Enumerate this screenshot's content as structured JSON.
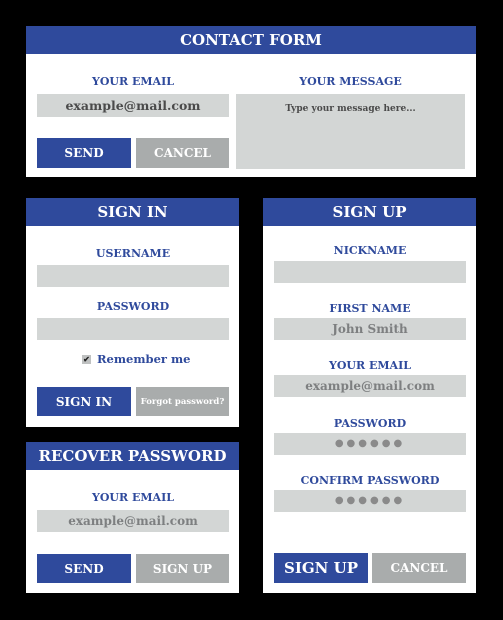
{
  "contact": {
    "title": "CONTACT FORM",
    "email_label": "YOUR EMAIL",
    "email_value": "example@mail.com",
    "message_label": "YOUR MESSAGE",
    "message_placeholder": "Type your message here...",
    "send": "SEND",
    "cancel": "CANCEL"
  },
  "signin": {
    "title": "SIGN IN",
    "username_label": "USERNAME",
    "username_value": "",
    "password_label": "PASSWORD",
    "password_value": "",
    "remember": "Remember me",
    "remember_checked": true,
    "check_glyph": "✔",
    "signin": "SIGN IN",
    "forgot": "Forgot password?"
  },
  "recover": {
    "title": "RECOVER PASSWORD",
    "email_label": "YOUR EMAIL",
    "email_placeholder": "example@mail.com",
    "send": "SEND",
    "signup": "SIGN UP"
  },
  "signup": {
    "title": "SIGN UP",
    "nickname_label": "NICKNAME",
    "nickname_value": "",
    "firstname_label": "FIRST NAME",
    "firstname_placeholder": "John Smith",
    "email_label": "YOUR EMAIL",
    "email_placeholder": "example@mail.com",
    "password_label": "PASSWORD",
    "password_mask": "●●●●●●",
    "confirm_label": "CONFIRM PASSWORD",
    "confirm_mask": "●●●●●●",
    "signup": "SIGN UP",
    "cancel": "CANCEL"
  },
  "colors": {
    "accent": "#2f4a9c",
    "field": "#d3d6d5",
    "secondary_button": "#a9acac"
  }
}
